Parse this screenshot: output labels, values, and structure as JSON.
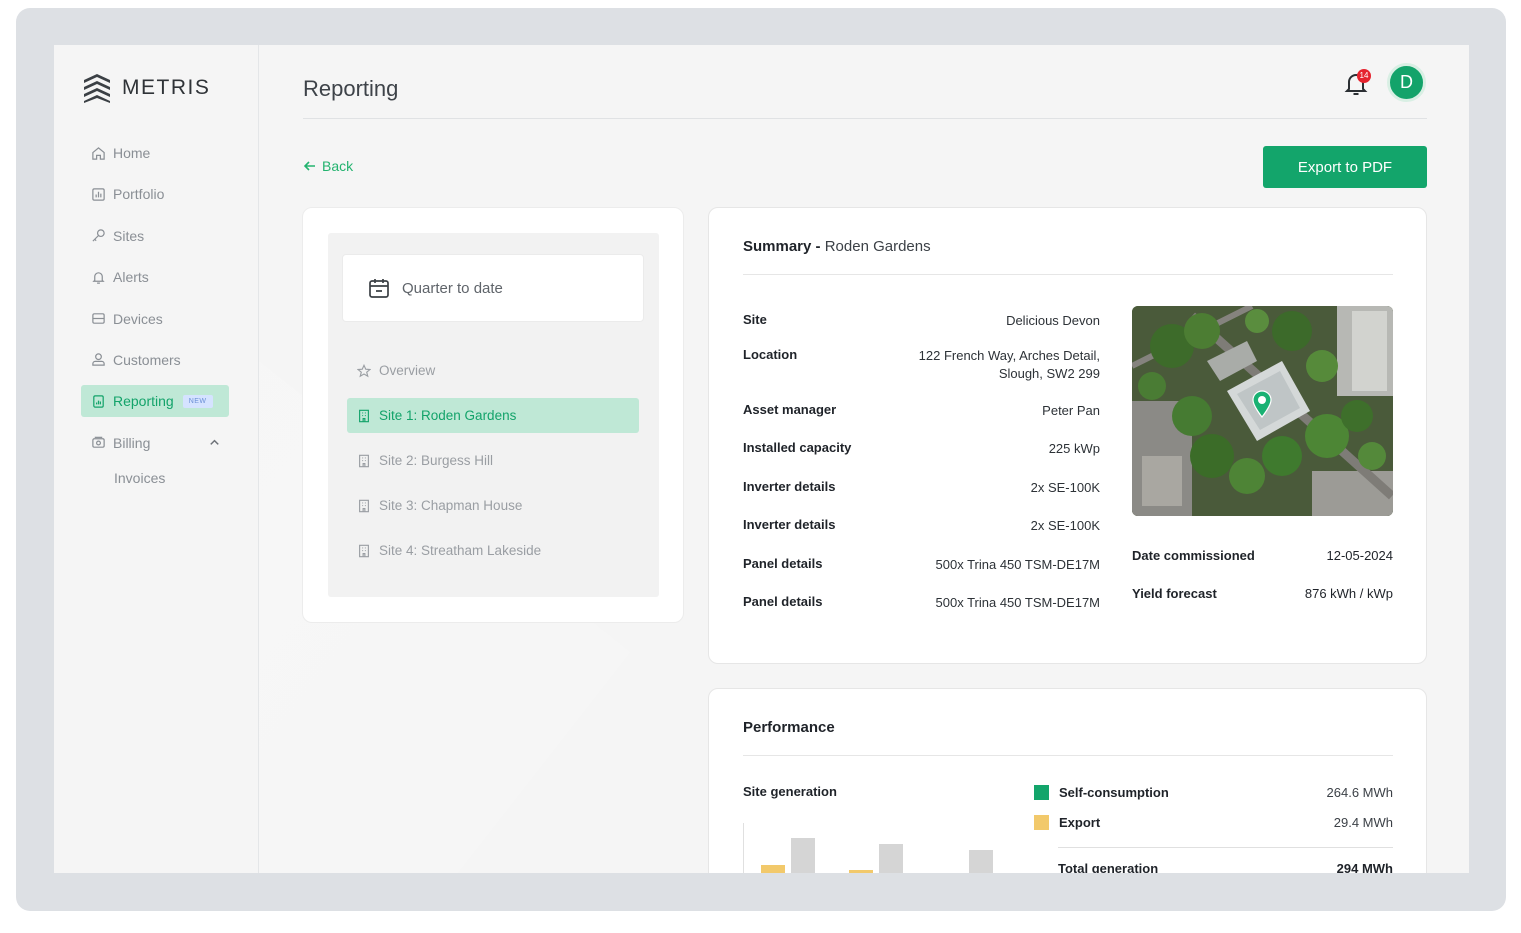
{
  "brand": {
    "name": "METRIS"
  },
  "sidebar": {
    "items": [
      {
        "label": "Home",
        "icon": "home-icon"
      },
      {
        "label": "Portfolio",
        "icon": "chart-icon"
      },
      {
        "label": "Sites",
        "icon": "key-icon"
      },
      {
        "label": "Alerts",
        "icon": "bell-icon"
      },
      {
        "label": "Devices",
        "icon": "device-icon"
      },
      {
        "label": "Customers",
        "icon": "users-icon"
      },
      {
        "label": "Reporting",
        "icon": "report-icon",
        "badge": "NEW",
        "active": true
      },
      {
        "label": "Billing",
        "icon": "billing-icon",
        "expanded": true
      }
    ],
    "sub_items": [
      "Invoices"
    ]
  },
  "header": {
    "title": "Reporting",
    "notifications_count": "14",
    "avatar_initial": "D"
  },
  "toolbar": {
    "back_label": "Back",
    "export_label": "Export to PDF"
  },
  "left_panel": {
    "period": "Quarter to date",
    "items": [
      {
        "label": "Overview",
        "icon": "star-icon"
      },
      {
        "label": "Site 1: Roden Gardens",
        "icon": "building-icon",
        "active": true
      },
      {
        "label": "Site 2: Burgess Hill",
        "icon": "building-icon"
      },
      {
        "label": "Site 3: Chapman House",
        "icon": "building-icon"
      },
      {
        "label": "Site 4: Streatham Lakeside",
        "icon": "building-icon"
      }
    ]
  },
  "summary": {
    "title_prefix": "Summary -",
    "title_site": "Roden Gardens",
    "fields": [
      {
        "key": "Site",
        "value": "Delicious Devon"
      },
      {
        "key": "Location",
        "value": "122 French Way, Arches Detail,",
        "value2": "Slough, SW2 299"
      },
      {
        "key": "Asset manager",
        "value": "Peter Pan"
      },
      {
        "key": "Installed capacity",
        "value": "225 kWp"
      },
      {
        "key": "Inverter details",
        "value": "2x SE-100K"
      },
      {
        "key": "Inverter details",
        "value": "2x SE-100K"
      },
      {
        "key": "Panel details",
        "value": "500x Trina 450 TSM-DE17M"
      },
      {
        "key": "Panel details",
        "value": "500x Trina 450 TSM-DE17M"
      }
    ],
    "side_fields": [
      {
        "key": "Date commissioned",
        "value": "12-05-2024"
      },
      {
        "key": "Yield forecast",
        "value": "876 kWh / kWp"
      }
    ]
  },
  "performance": {
    "title": "Performance",
    "chart_label": "Site generation",
    "legend": [
      {
        "label": "Self-consumption",
        "value": "264.6 MWh",
        "color": "#13a56b"
      },
      {
        "label": "Export",
        "value": "29.4 MWh",
        "color": "#f2c96b"
      }
    ],
    "total_label": "Total generation",
    "total_value": "294 MWh"
  },
  "colors": {
    "accent": "#13a56b",
    "accent_light": "#bfe8d6",
    "notification": "#e5232e"
  }
}
